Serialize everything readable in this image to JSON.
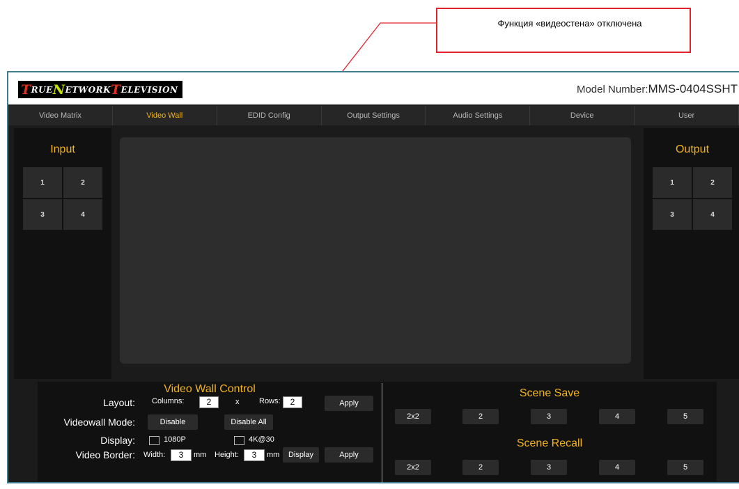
{
  "callout": {
    "text": "Функция «видеостена» отключена",
    "color": "#e0232a"
  },
  "header": {
    "logo": {
      "text": "True Network Television",
      "l1": "T",
      "w1": "RUE ",
      "l2": "N",
      "w2": "ETWORK ",
      "l3": "T",
      "w3": "ELEVISION"
    },
    "model_label": "Model Number:",
    "model_value": "MMS-0404SSHT"
  },
  "tabs": [
    {
      "label": "Video Matrix"
    },
    {
      "label": "Video Wall"
    },
    {
      "label": "EDID Config"
    },
    {
      "label": "Output Settings"
    },
    {
      "label": "Audio Settings"
    },
    {
      "label": "Device"
    },
    {
      "label": "User"
    }
  ],
  "active_tab": "Video Wall",
  "input_panel": {
    "title": "Input",
    "ports": [
      "1",
      "2",
      "3",
      "4"
    ]
  },
  "output_panel": {
    "title": "Output",
    "ports": [
      "1",
      "2",
      "3",
      "4"
    ]
  },
  "video_wall_control": {
    "title": "Video Wall Control",
    "layout_label": "Layout:",
    "columns_label": "Columns:",
    "columns_value": "2",
    "x_label": "x",
    "rows_label": "Rows:",
    "rows_value": "2",
    "apply_label": "Apply",
    "mode_label": "Videowall Mode:",
    "disable_label": "Disable",
    "disable_all_label": "Disable All",
    "display_label": "Display:",
    "opt_1080": "1080P",
    "opt_4k": "4K@30",
    "border_label": "Video Border:",
    "width_label": "Width:",
    "width_value": "3",
    "mm1": "mm",
    "height_label": "Height:",
    "height_value": "3",
    "mm2": "mm",
    "display_btn": "Display",
    "apply2_label": "Apply"
  },
  "scene_save": {
    "title": "Scene Save",
    "buttons": [
      "2x2",
      "2",
      "3",
      "4",
      "5"
    ]
  },
  "scene_recall": {
    "title": "Scene Recall",
    "buttons": [
      "2x2",
      "2",
      "3",
      "4",
      "5"
    ]
  },
  "colors": {
    "accent": "#f2b31c",
    "frame": "#3d7d8f",
    "background": "#1b1b1b"
  }
}
